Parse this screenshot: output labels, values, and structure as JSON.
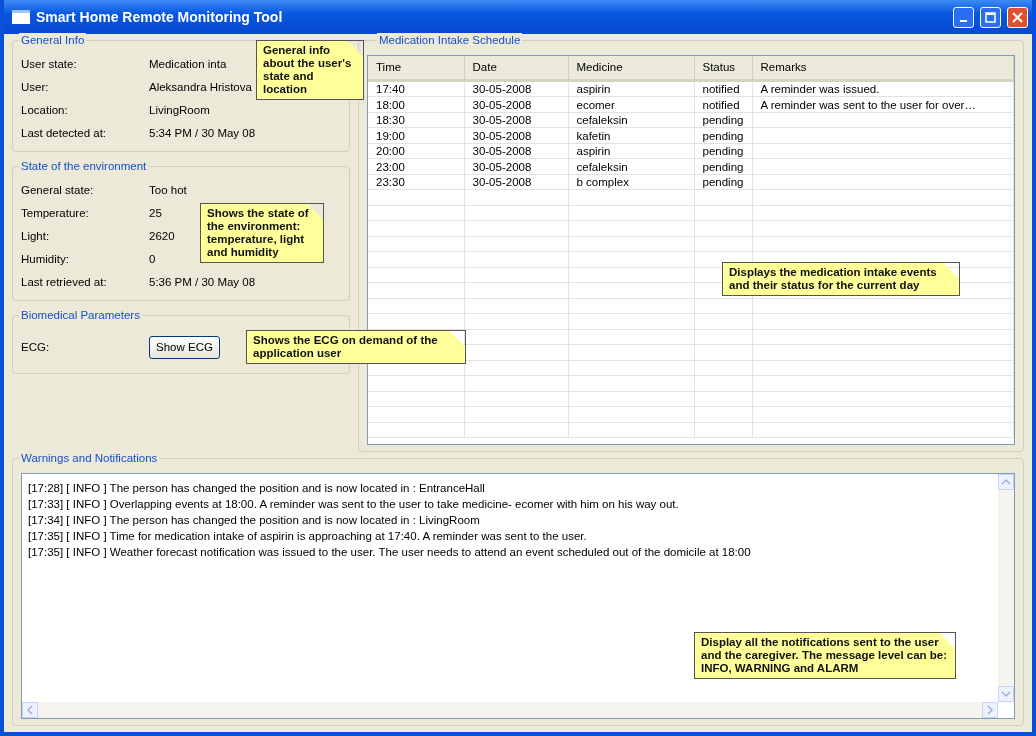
{
  "window": {
    "title": "Smart Home Remote Monitoring Tool"
  },
  "general_info": {
    "title": "General Info",
    "fields": [
      {
        "label": "User state:",
        "value": "Medication inta"
      },
      {
        "label": "User:",
        "value": "Aleksandra Hristova"
      },
      {
        "label": "Location:",
        "value": "LivingRoom"
      },
      {
        "label": "Last detected at:",
        "value": "5:34 PM  /  30 May 08"
      }
    ]
  },
  "environment": {
    "title": "State of the environment",
    "fields": [
      {
        "label": "General state:",
        "value": "Too hot"
      },
      {
        "label": "Temperature:",
        "value": "25"
      },
      {
        "label": "Light:",
        "value": "2620"
      },
      {
        "label": "Humidity:",
        "value": "0"
      },
      {
        "label": "Last retrieved at:",
        "value": "5:36 PM  /  30 May 08"
      }
    ]
  },
  "biomedical": {
    "title": "Biomedical Parameters",
    "label": "ECG:",
    "button": "Show ECG"
  },
  "schedule": {
    "title": "Medication Intake Schedule",
    "columns": [
      "Time",
      "Date",
      "Medicine",
      "Status",
      "Remarks"
    ],
    "rows": [
      [
        "17:40",
        "30-05-2008",
        "aspirin",
        "notified",
        "A reminder was issued."
      ],
      [
        "18:00",
        "30-05-2008",
        "ecomer",
        "notified",
        "A reminder was sent to the user for over…"
      ],
      [
        "18:30",
        "30-05-2008",
        "cefaleksin",
        "pending",
        ""
      ],
      [
        "19:00",
        "30-05-2008",
        "kafetin",
        "pending",
        ""
      ],
      [
        "20:00",
        "30-05-2008",
        "aspirin",
        "pending",
        ""
      ],
      [
        "23:00",
        "30-05-2008",
        "cefaleksin",
        "pending",
        ""
      ],
      [
        "23:30",
        "30-05-2008",
        "b complex",
        "pending",
        ""
      ]
    ]
  },
  "notifications": {
    "title": "Warnings and Notifications",
    "lines": [
      "[17:28] [ INFO ] The person has changed the position and is now located in : EntranceHall",
      "[17:33] [ INFO ] Overlapping events at 18:00. A reminder was sent to the user to take medicine- ecomer with him on his way out.",
      "[17:34] [ INFO ] The person has changed the position and is now located in : LivingRoom",
      "[17:35] [ INFO ] Time for medication intake of aspirin is approaching at 17:40. A reminder was sent to the user.",
      "[17:35] [ INFO ] Weather forecast notification was issued to the user. The user needs to attend an event scheduled out of the domicile at 18:00"
    ]
  },
  "callouts": [
    {
      "text": "General info about the user's state and location"
    },
    {
      "text": "Shows the state of the environment: temperature, light and humidity"
    },
    {
      "text": "Shows the ECG on demand of the application user"
    },
    {
      "text": "Displays the medication intake events and their status for the current day"
    },
    {
      "text": "Display all the notifications sent to the user and the caregiver. The message level can be: INFO, WARNING and ALARM"
    }
  ]
}
